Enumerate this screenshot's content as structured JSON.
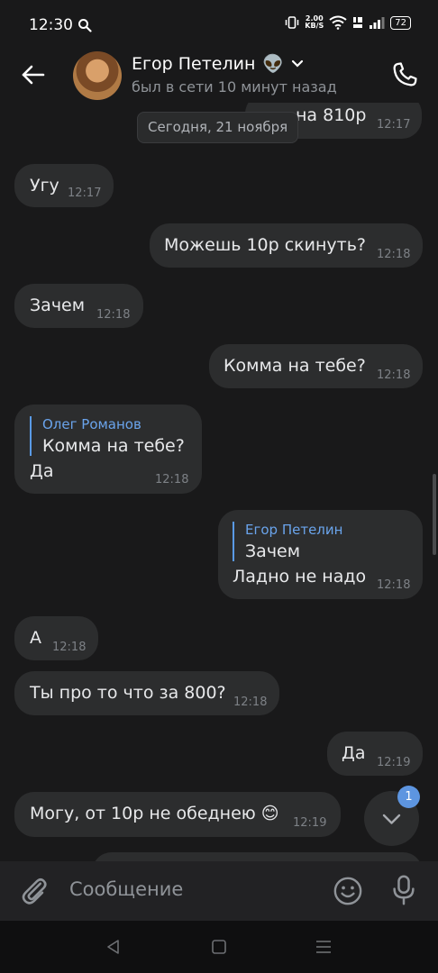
{
  "status": {
    "time": "12:30",
    "speed_value": "2.00",
    "speed_unit": "KB/S",
    "battery": "72"
  },
  "header": {
    "contact_name": "Егор Петелин",
    "contact_emoji": "👽",
    "last_seen": "был в сети 10 минут назад"
  },
  "date_chip": "Сегодня, 21 ноября",
  "messages": [
    {
      "text": "на 810р",
      "time": "12:17"
    },
    {
      "text": "Угу",
      "time": "12:17"
    },
    {
      "text": "Можешь 10р скинуть?",
      "time": "12:18"
    },
    {
      "text": "Зачем",
      "time": "12:18"
    },
    {
      "text": "Комма на тебе?",
      "time": "12:18"
    },
    {
      "text": "Да",
      "time": "12:18",
      "reply_author": "Олег Романов",
      "reply_text": "Комма на тебе?"
    },
    {
      "text": "Ладно не надо",
      "time": "12:18",
      "reply_author": "Егор Петелин",
      "reply_text": "Зачем"
    },
    {
      "text": "А",
      "time": "12:18"
    },
    {
      "text": "Ты про то что за 800?",
      "time": "12:18"
    },
    {
      "text": "Да",
      "time": "12:19"
    },
    {
      "text": "Могу, от 10р не обеднею 😊",
      "time": "12:19"
    }
  ],
  "scroll_badge": "1",
  "composer": {
    "placeholder": "Сообщение"
  },
  "icons": [
    "search-icon",
    "vibrate-icon",
    "wifi-icon",
    "volte-icon",
    "signal-icon",
    "back-arrow-icon",
    "chevron-down-icon",
    "phone-icon",
    "chevron-down-icon",
    "attach-icon",
    "emoji-icon",
    "mic-icon",
    "nav-back-icon",
    "nav-home-icon",
    "nav-recents-icon"
  ],
  "colors": {
    "background": "#19191a",
    "bubble": "#2c2d2e",
    "accent": "#5d95e0",
    "reply_author": "#6aa4ec"
  }
}
